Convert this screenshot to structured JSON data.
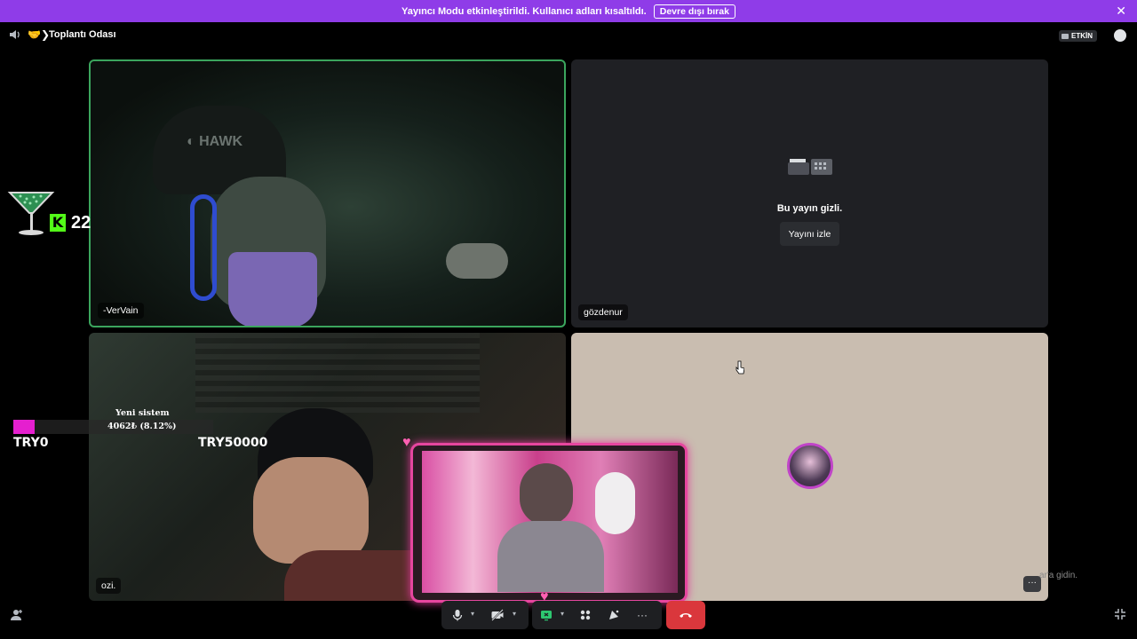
{
  "banner": {
    "message": "Yayıncı Modu etkinleştirildi. Kullanıcı adları kısaltıldı.",
    "disable_label": "Devre dışı bırak",
    "close_icon": "close-icon"
  },
  "header": {
    "channel_emoji": "🤝❯",
    "channel_name": "Toplantı Odası",
    "status_label": "ETKİN"
  },
  "tiles": [
    {
      "name": "-VerVain",
      "speaking": true
    },
    {
      "name": "gözdenur",
      "hidden_text": "Bu yayın gizli.",
      "watch_label": "Yayını izle"
    },
    {
      "name": "ozi."
    },
    {
      "name": ""
    }
  ],
  "overlay": {
    "kick_count": "22",
    "kick_letter": "K",
    "goal_title": "Yeni sistem",
    "goal_amount": "4062₺ (8.12%)",
    "goal_progress": 0.0812,
    "goal_min": "TRY0",
    "goal_max": "TRY50000"
  },
  "background_text": "ar'a gidin.",
  "more_label": "···",
  "colors": {
    "banner": "#8f3ce8",
    "speaking_border": "#3ba55d",
    "end_call": "#da373c",
    "kick_green": "#53fc18",
    "goal_fill": "#e51fcf"
  },
  "controls": {
    "icons": [
      "microphone-icon",
      "camera-off-icon",
      "screen-share-icon",
      "activities-icon",
      "soundboard-icon",
      "more-icon",
      "end-call-icon"
    ]
  }
}
